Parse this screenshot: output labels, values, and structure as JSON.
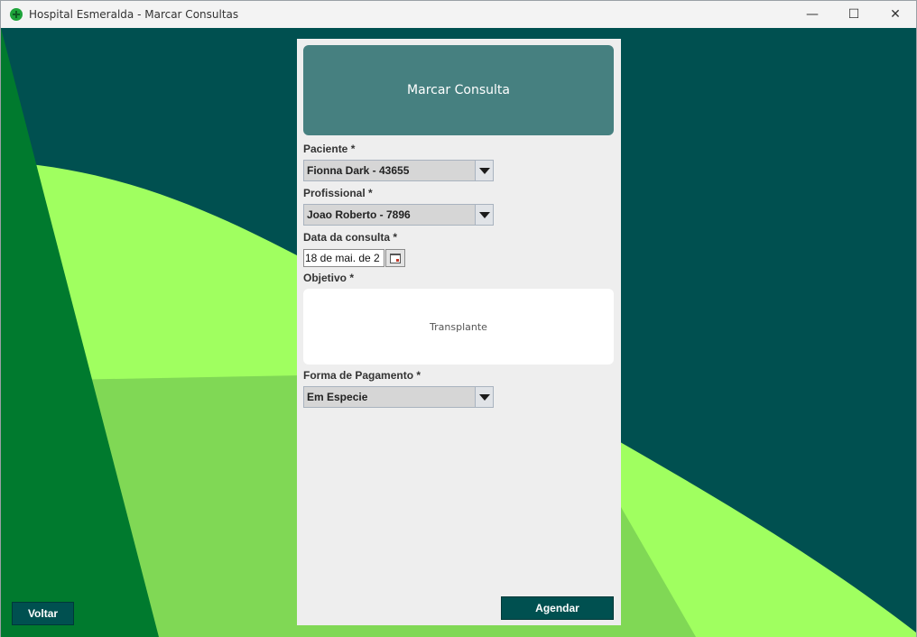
{
  "window": {
    "title": "Hospital Esmeralda - Marcar Consultas",
    "minimize": "—",
    "maximize": "☐",
    "close": "✕"
  },
  "form": {
    "header": "Marcar Consulta",
    "paciente_label": "Paciente *",
    "paciente_value": "Fionna Dark - 43655",
    "profissional_label": "Profissional *",
    "profissional_value": "Joao Roberto - 7896",
    "data_label": "Data da consulta *",
    "data_value": "18 de mai. de 2",
    "objetivo_label": "Objetivo *",
    "objetivo_value": "Transplante",
    "pagamento_label": "Forma de Pagamento *",
    "pagamento_value": "Em Especie",
    "agendar_label": "Agendar"
  },
  "nav": {
    "voltar_label": "Voltar"
  },
  "colors": {
    "background_dark": "#005050",
    "green_dark": "#007a2e",
    "green_light": "#a0ff60",
    "green_mid": "#80d855",
    "header_teal": "#468080"
  }
}
